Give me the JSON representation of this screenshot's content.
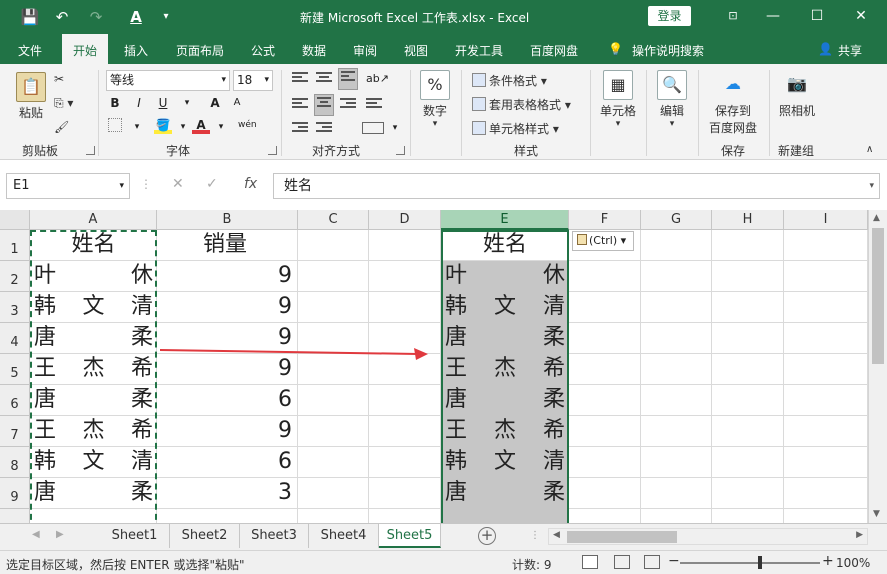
{
  "title_bar": {
    "title": "新建 Microsoft Excel 工作表.xlsx  -  Excel",
    "login": "登录",
    "minimize": "—",
    "restore": "☐",
    "close": "✕"
  },
  "menu": {
    "file": "文件",
    "home": "开始",
    "insert": "插入",
    "page_layout": "页面布局",
    "formulas": "公式",
    "data": "数据",
    "review": "审阅",
    "view": "视图",
    "developer": "开发工具",
    "baidu": "百度网盘",
    "tell_me": "操作说明搜索",
    "share": "共享"
  },
  "ribbon": {
    "clipboard": {
      "paste": "粘贴",
      "label": "剪贴板"
    },
    "font": {
      "name": "等线",
      "size": "18",
      "bold": "B",
      "italic": "I",
      "underline": "U",
      "grow": "A",
      "shrink": "A",
      "label": "字体",
      "phonetic": "wén"
    },
    "alignment": {
      "label": "对齐方式"
    },
    "number": {
      "format": "数字",
      "symbol": "%"
    },
    "styles": {
      "conditional": "条件格式",
      "table": "套用表格格式",
      "cell_styles": "单元格样式",
      "label": "样式"
    },
    "cells": {
      "label": "单元格"
    },
    "editing": {
      "label": "编辑"
    },
    "baidu": {
      "save": "保存到",
      "save2": "百度网盘",
      "label": "保存"
    },
    "camera": {
      "label": "照相机",
      "group": "新建组"
    }
  },
  "formula_bar": {
    "name_box": "E1",
    "formula": "姓名"
  },
  "columns": [
    "A",
    "B",
    "C",
    "D",
    "E",
    "F",
    "G",
    "H",
    "I"
  ],
  "rows": [
    "1",
    "2",
    "3",
    "4",
    "5",
    "6",
    "7",
    "8",
    "9"
  ],
  "sheet": {
    "col_a": [
      "姓名",
      "叶休",
      "韩文清",
      "唐柔",
      "王杰希",
      "唐柔",
      "王杰希",
      "韩文清",
      "唐柔"
    ],
    "col_b_header": "销量",
    "col_b": [
      "9",
      "9",
      "9",
      "9",
      "6",
      "9",
      "6",
      "3"
    ],
    "col_e": [
      "姓名",
      "叶休",
      "韩文清",
      "唐柔",
      "王杰希",
      "唐柔",
      "王杰希",
      "韩文清",
      "唐柔"
    ]
  },
  "paste_options": "(Ctrl)",
  "sheet_tabs": [
    "Sheet1",
    "Sheet2",
    "Sheet3",
    "Sheet4",
    "Sheet5"
  ],
  "active_sheet": "Sheet5",
  "status": {
    "message": "选定目标区域，然后按 ENTER 或选择\"粘贴\"",
    "count": "计数: 9",
    "zoom": "100%"
  },
  "colors": {
    "accent": "#217346",
    "arrow": "#e0393e"
  }
}
